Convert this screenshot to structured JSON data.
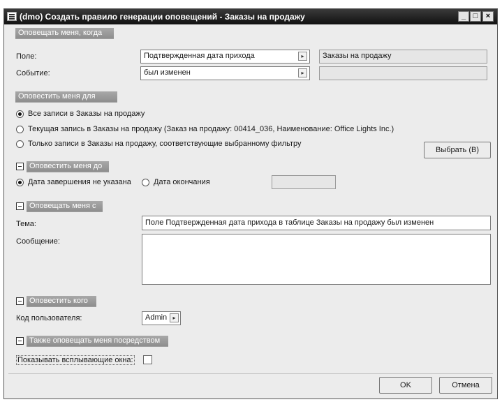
{
  "window": {
    "title": "(dmo) Создать правило генерации оповещений - Заказы на продажу",
    "min_label": "_",
    "max_label": "□",
    "close_label": "×"
  },
  "notify_when": {
    "header": "Оповещать меня, когда",
    "field_label": "Поле:",
    "field_value": "Подтвержденная дата прихода",
    "field_table": "Заказы на продажу",
    "event_label": "Событие:",
    "event_value": "был изменен",
    "event_extra": ""
  },
  "notify_for": {
    "header": "Оповестить меня для",
    "options": [
      {
        "label": "Все записи в Заказы на продажу",
        "selected": true
      },
      {
        "label": "Текущая запись в Заказы на продажу (Заказ на продажу: 00414_036, Наименование: Office Lights Inc.)",
        "selected": false
      },
      {
        "label": "Только записи в Заказы на продажу, соответствующие выбранному фильтру",
        "selected": false
      }
    ],
    "select_button": "Выбрать (В)"
  },
  "notify_until": {
    "header": "Оповестить меня до",
    "no_end_label": "Дата завершения не указана",
    "no_end_selected": true,
    "end_date_label": "Дата окончания",
    "end_date_selected": false,
    "end_date_value": ""
  },
  "notify_with": {
    "header": "Оповещать меня с",
    "subject_label": "Тема:",
    "subject_value": "Поле Подтвержденная дата прихода в таблице Заказы на продажу был изменен",
    "message_label": "Сообщение:",
    "message_value": ""
  },
  "notify_who": {
    "header": "Оповестить кого",
    "user_label": "Код пользователя:",
    "user_value": "Admin"
  },
  "also_notify": {
    "header": "Также оповещать меня посредством",
    "popup_label": "Показывать всплывающие окна:",
    "popup_checked": false
  },
  "footer": {
    "ok_label": "OK",
    "cancel_label": "Отмена"
  }
}
